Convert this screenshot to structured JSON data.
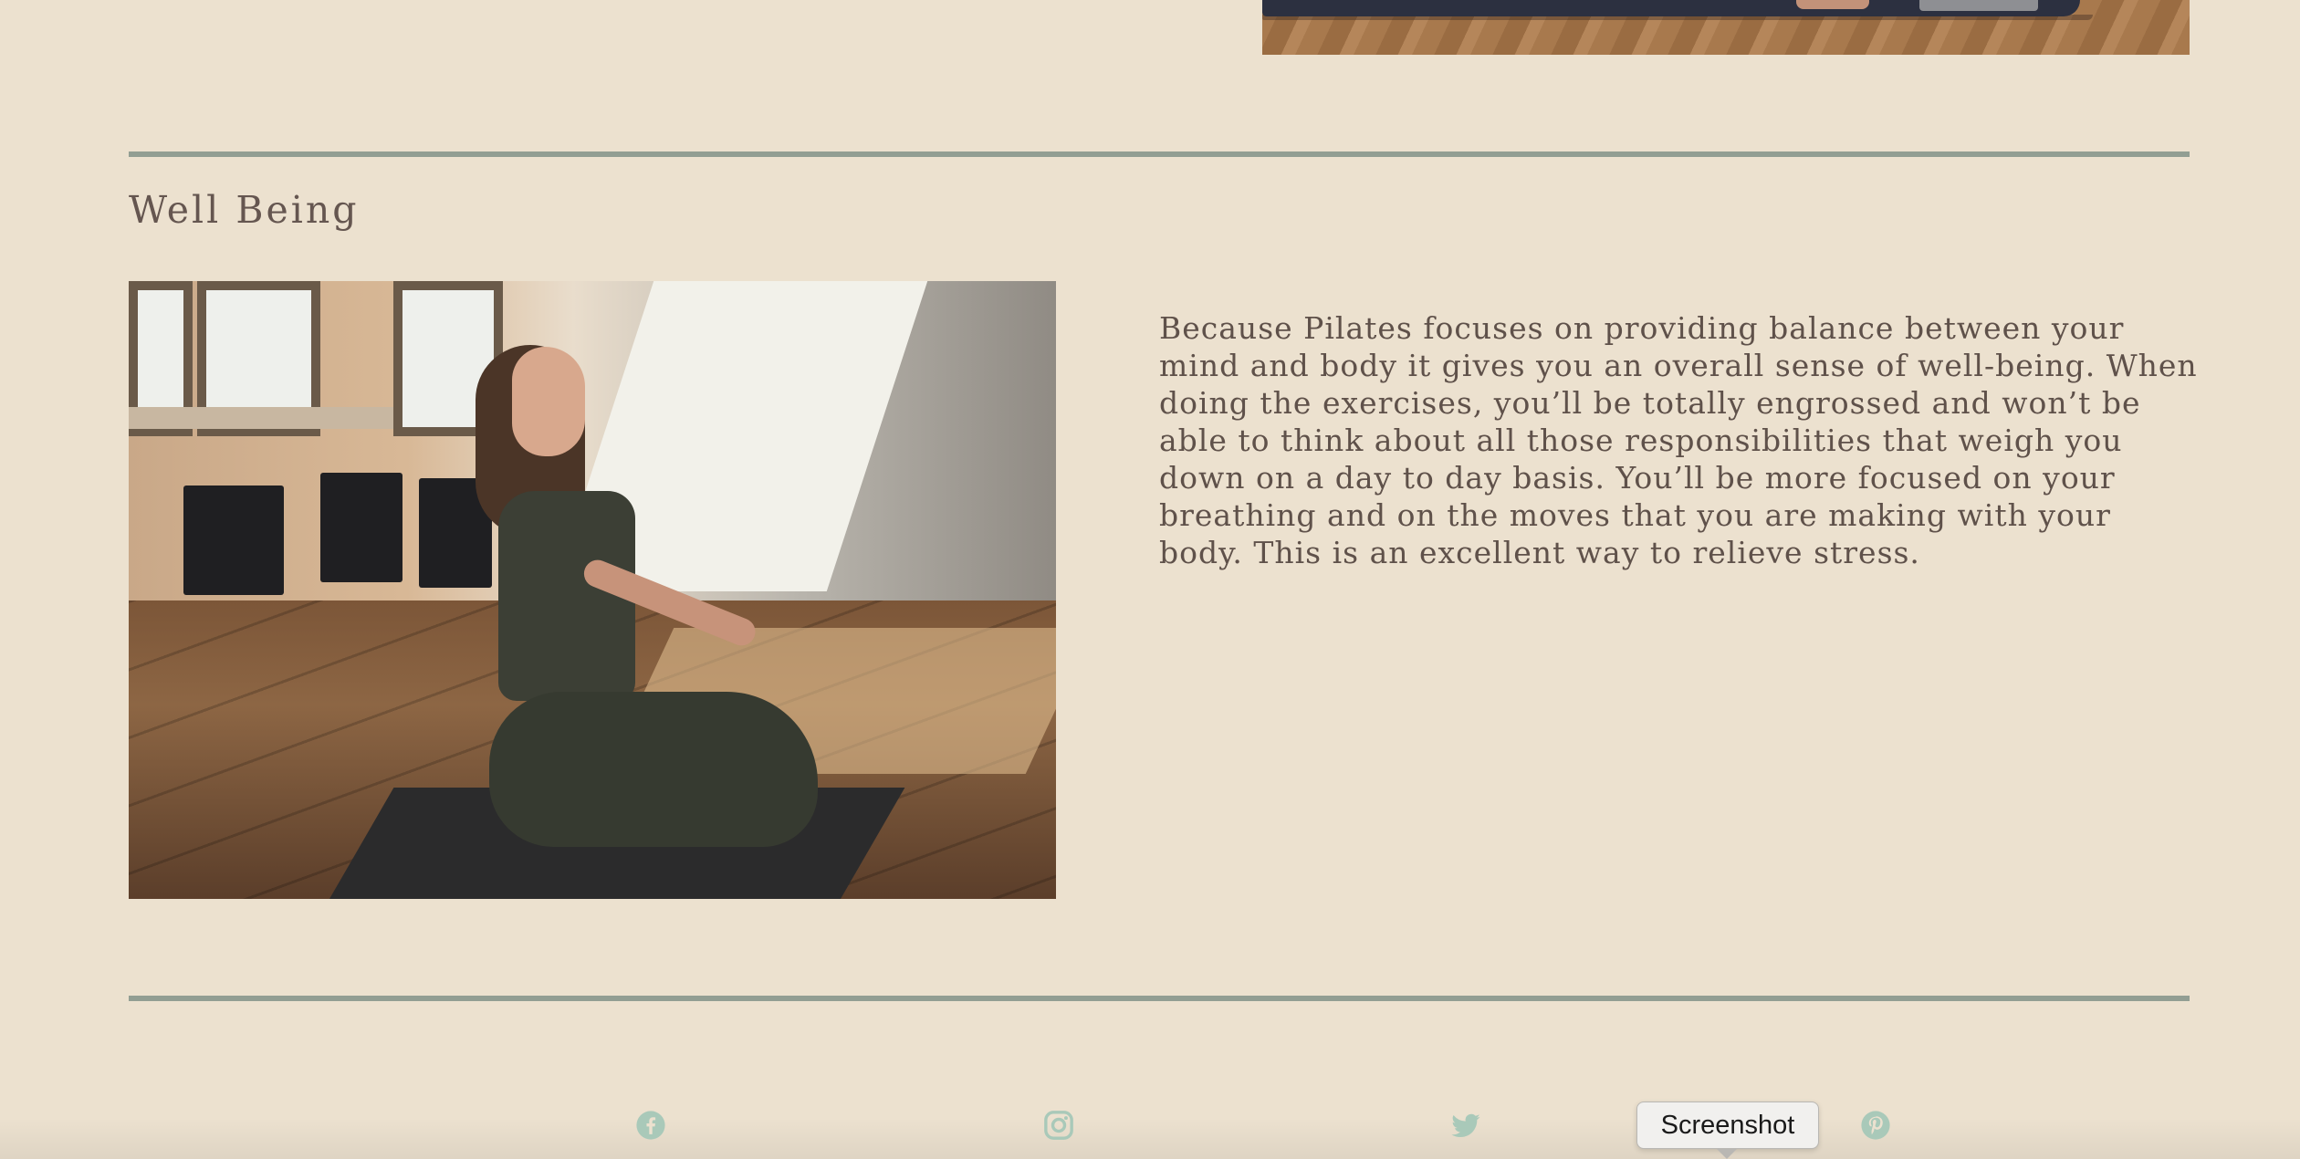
{
  "section": {
    "title": "Well Being",
    "body": "Because Pilates focuses on providing balance between your mind and body it gives you an overall sense of well-being. When doing the exercises, you’ll be totally engrossed and won’t be able to think about all those responsibilities that weigh you down on a day to day basis. You’ll be more focused on your breathing and on the moves that you are making with your body. This is an excellent way to relieve stress."
  },
  "footer": {
    "social": [
      {
        "icon": "facebook-icon"
      },
      {
        "icon": "instagram-icon"
      },
      {
        "icon": "twitter-icon"
      },
      {
        "icon": "pinterest-icon"
      }
    ],
    "tooltip": "Screenshot"
  },
  "colors": {
    "background": "#ece1cf",
    "rule": "#929e93",
    "text": "#5f514a",
    "social_icon": "#a9c9b9"
  }
}
